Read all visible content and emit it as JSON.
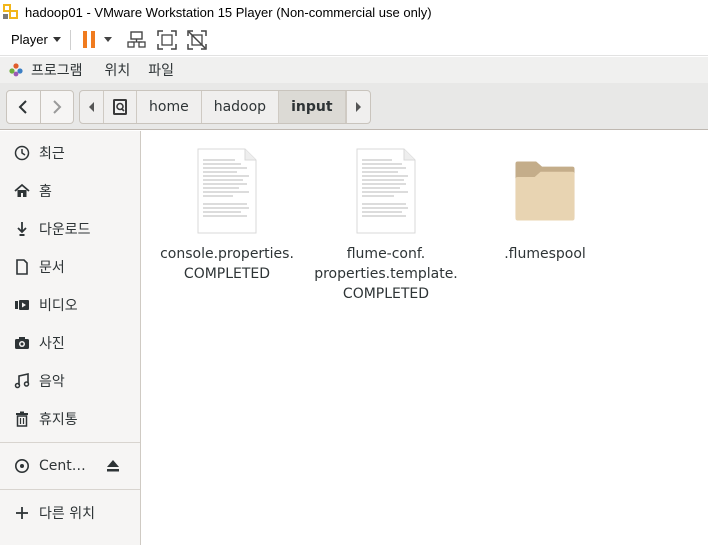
{
  "window": {
    "title": "hadoop01 - VMware Workstation 15 Player (Non-commercial use only)"
  },
  "vm_toolbar": {
    "player_label": "Player"
  },
  "guest_menu": {
    "items": [
      "프로그램",
      "위치",
      "파일"
    ]
  },
  "pathbar": {
    "segments": [
      "home",
      "hadoop",
      "input"
    ],
    "active": "input"
  },
  "sidebar": {
    "items": [
      {
        "label": "최근",
        "icon": "recent-clock-icon"
      },
      {
        "label": "홈",
        "icon": "home-icon"
      },
      {
        "label": "다운로드",
        "icon": "download-icon"
      },
      {
        "label": "문서",
        "icon": "document-icon"
      },
      {
        "label": "비디오",
        "icon": "video-icon"
      },
      {
        "label": "사진",
        "icon": "camera-icon"
      },
      {
        "label": "음악",
        "icon": "music-icon"
      },
      {
        "label": "휴지통",
        "icon": "trash-icon"
      }
    ],
    "device": {
      "label": "Cent…",
      "icon": "disc-icon"
    },
    "other_locations": {
      "label": "다른 위치",
      "icon": "plus-icon"
    }
  },
  "files": [
    {
      "name_lines": [
        "console.properties.",
        "COMPLETED"
      ],
      "type": "text-file"
    },
    {
      "name_lines": [
        "flume-conf.",
        "properties.template.",
        "COMPLETED"
      ],
      "type": "text-file"
    },
    {
      "name_lines": [
        ".flumespool"
      ],
      "type": "folder"
    }
  ],
  "colors": {
    "accent_pause": "#f07b1f",
    "folder": "#e8d4b2",
    "folder_tab": "#c4ad8a",
    "sidebar_bg": "#f6f5f4",
    "headerbar_bg": "#e8e8e7"
  }
}
